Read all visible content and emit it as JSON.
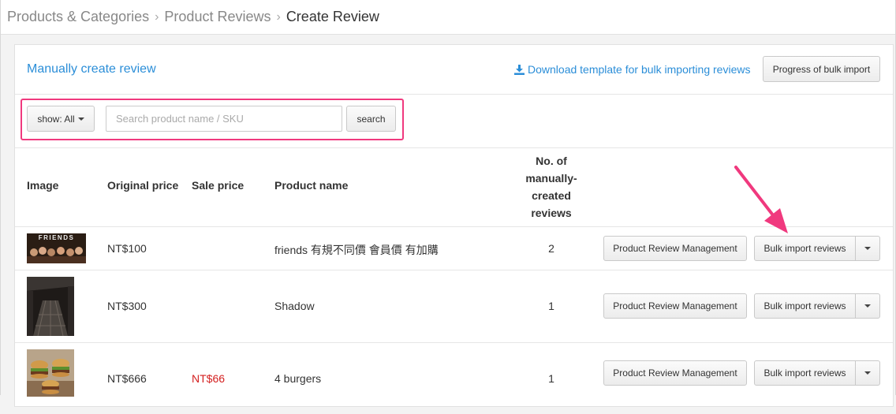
{
  "breadcrumb": {
    "items": [
      "Products & Categories",
      "Product Reviews"
    ],
    "current": "Create Review"
  },
  "header": {
    "title": "Manually create review",
    "download_link": "Download template for bulk importing reviews",
    "progress_button": "Progress of bulk import"
  },
  "filter": {
    "show_label": "show: All",
    "search_placeholder": "Search product name / SKU",
    "search_button": "search"
  },
  "table": {
    "headers": {
      "image": "Image",
      "original_price": "Original price",
      "sale_price": "Sale price",
      "product_name": "Product name",
      "count_lines": [
        "No. of",
        "manually-",
        "created",
        "reviews"
      ]
    },
    "rows": [
      {
        "original_price": "NT$100",
        "sale_price": "",
        "name": "friends 有規不同價 會員價 有加購",
        "count": "2",
        "thumb_text": "FRIENDS"
      },
      {
        "original_price": "NT$300",
        "sale_price": "",
        "name": "Shadow",
        "count": "1"
      },
      {
        "original_price": "NT$666",
        "sale_price": "NT$66",
        "name": "4 burgers",
        "count": "1"
      }
    ],
    "row_buttons": {
      "management": "Product Review Management",
      "bulk_import": "Bulk import reviews"
    }
  },
  "colors": {
    "accent": "#2b8ed8",
    "highlight": "#f0397e",
    "sale": "#d42020"
  }
}
